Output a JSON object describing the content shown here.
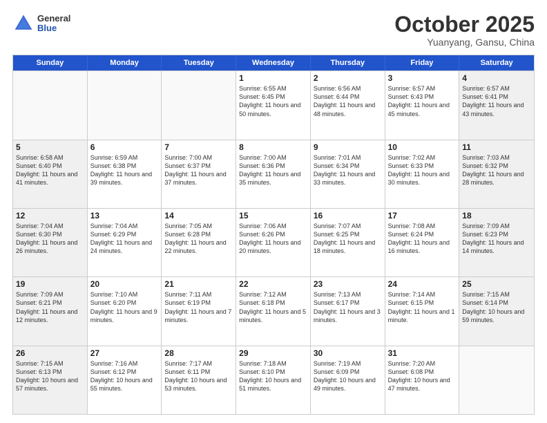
{
  "header": {
    "logo": {
      "general": "General",
      "blue": "Blue"
    },
    "title": "October 2025",
    "location": "Yuanyang, Gansu, China"
  },
  "weekdays": [
    "Sunday",
    "Monday",
    "Tuesday",
    "Wednesday",
    "Thursday",
    "Friday",
    "Saturday"
  ],
  "rows": [
    [
      {
        "day": "",
        "info": "",
        "empty": true
      },
      {
        "day": "",
        "info": "",
        "empty": true
      },
      {
        "day": "",
        "info": "",
        "empty": true
      },
      {
        "day": "1",
        "info": "Sunrise: 6:55 AM\nSunset: 6:45 PM\nDaylight: 11 hours\nand 50 minutes.",
        "empty": false
      },
      {
        "day": "2",
        "info": "Sunrise: 6:56 AM\nSunset: 6:44 PM\nDaylight: 11 hours\nand 48 minutes.",
        "empty": false
      },
      {
        "day": "3",
        "info": "Sunrise: 6:57 AM\nSunset: 6:43 PM\nDaylight: 11 hours\nand 45 minutes.",
        "empty": false
      },
      {
        "day": "4",
        "info": "Sunrise: 6:57 AM\nSunset: 6:41 PM\nDaylight: 11 hours\nand 43 minutes.",
        "empty": false,
        "shaded": true
      }
    ],
    [
      {
        "day": "5",
        "info": "Sunrise: 6:58 AM\nSunset: 6:40 PM\nDaylight: 11 hours\nand 41 minutes.",
        "empty": false,
        "shaded": true
      },
      {
        "day": "6",
        "info": "Sunrise: 6:59 AM\nSunset: 6:38 PM\nDaylight: 11 hours\nand 39 minutes.",
        "empty": false
      },
      {
        "day": "7",
        "info": "Sunrise: 7:00 AM\nSunset: 6:37 PM\nDaylight: 11 hours\nand 37 minutes.",
        "empty": false
      },
      {
        "day": "8",
        "info": "Sunrise: 7:00 AM\nSunset: 6:36 PM\nDaylight: 11 hours\nand 35 minutes.",
        "empty": false
      },
      {
        "day": "9",
        "info": "Sunrise: 7:01 AM\nSunset: 6:34 PM\nDaylight: 11 hours\nand 33 minutes.",
        "empty": false
      },
      {
        "day": "10",
        "info": "Sunrise: 7:02 AM\nSunset: 6:33 PM\nDaylight: 11 hours\nand 30 minutes.",
        "empty": false
      },
      {
        "day": "11",
        "info": "Sunrise: 7:03 AM\nSunset: 6:32 PM\nDaylight: 11 hours\nand 28 minutes.",
        "empty": false,
        "shaded": true
      }
    ],
    [
      {
        "day": "12",
        "info": "Sunrise: 7:04 AM\nSunset: 6:30 PM\nDaylight: 11 hours\nand 26 minutes.",
        "empty": false,
        "shaded": true
      },
      {
        "day": "13",
        "info": "Sunrise: 7:04 AM\nSunset: 6:29 PM\nDaylight: 11 hours\nand 24 minutes.",
        "empty": false
      },
      {
        "day": "14",
        "info": "Sunrise: 7:05 AM\nSunset: 6:28 PM\nDaylight: 11 hours\nand 22 minutes.",
        "empty": false
      },
      {
        "day": "15",
        "info": "Sunrise: 7:06 AM\nSunset: 6:26 PM\nDaylight: 11 hours\nand 20 minutes.",
        "empty": false
      },
      {
        "day": "16",
        "info": "Sunrise: 7:07 AM\nSunset: 6:25 PM\nDaylight: 11 hours\nand 18 minutes.",
        "empty": false
      },
      {
        "day": "17",
        "info": "Sunrise: 7:08 AM\nSunset: 6:24 PM\nDaylight: 11 hours\nand 16 minutes.",
        "empty": false
      },
      {
        "day": "18",
        "info": "Sunrise: 7:09 AM\nSunset: 6:23 PM\nDaylight: 11 hours\nand 14 minutes.",
        "empty": false,
        "shaded": true
      }
    ],
    [
      {
        "day": "19",
        "info": "Sunrise: 7:09 AM\nSunset: 6:21 PM\nDaylight: 11 hours\nand 12 minutes.",
        "empty": false,
        "shaded": true
      },
      {
        "day": "20",
        "info": "Sunrise: 7:10 AM\nSunset: 6:20 PM\nDaylight: 11 hours\nand 9 minutes.",
        "empty": false
      },
      {
        "day": "21",
        "info": "Sunrise: 7:11 AM\nSunset: 6:19 PM\nDaylight: 11 hours\nand 7 minutes.",
        "empty": false
      },
      {
        "day": "22",
        "info": "Sunrise: 7:12 AM\nSunset: 6:18 PM\nDaylight: 11 hours\nand 5 minutes.",
        "empty": false
      },
      {
        "day": "23",
        "info": "Sunrise: 7:13 AM\nSunset: 6:17 PM\nDaylight: 11 hours\nand 3 minutes.",
        "empty": false
      },
      {
        "day": "24",
        "info": "Sunrise: 7:14 AM\nSunset: 6:15 PM\nDaylight: 11 hours\nand 1 minute.",
        "empty": false
      },
      {
        "day": "25",
        "info": "Sunrise: 7:15 AM\nSunset: 6:14 PM\nDaylight: 10 hours\nand 59 minutes.",
        "empty": false,
        "shaded": true
      }
    ],
    [
      {
        "day": "26",
        "info": "Sunrise: 7:15 AM\nSunset: 6:13 PM\nDaylight: 10 hours\nand 57 minutes.",
        "empty": false,
        "shaded": true
      },
      {
        "day": "27",
        "info": "Sunrise: 7:16 AM\nSunset: 6:12 PM\nDaylight: 10 hours\nand 55 minutes.",
        "empty": false
      },
      {
        "day": "28",
        "info": "Sunrise: 7:17 AM\nSunset: 6:11 PM\nDaylight: 10 hours\nand 53 minutes.",
        "empty": false
      },
      {
        "day": "29",
        "info": "Sunrise: 7:18 AM\nSunset: 6:10 PM\nDaylight: 10 hours\nand 51 minutes.",
        "empty": false
      },
      {
        "day": "30",
        "info": "Sunrise: 7:19 AM\nSunset: 6:09 PM\nDaylight: 10 hours\nand 49 minutes.",
        "empty": false
      },
      {
        "day": "31",
        "info": "Sunrise: 7:20 AM\nSunset: 6:08 PM\nDaylight: 10 hours\nand 47 minutes.",
        "empty": false
      },
      {
        "day": "",
        "info": "",
        "empty": true,
        "shaded": true
      }
    ]
  ]
}
